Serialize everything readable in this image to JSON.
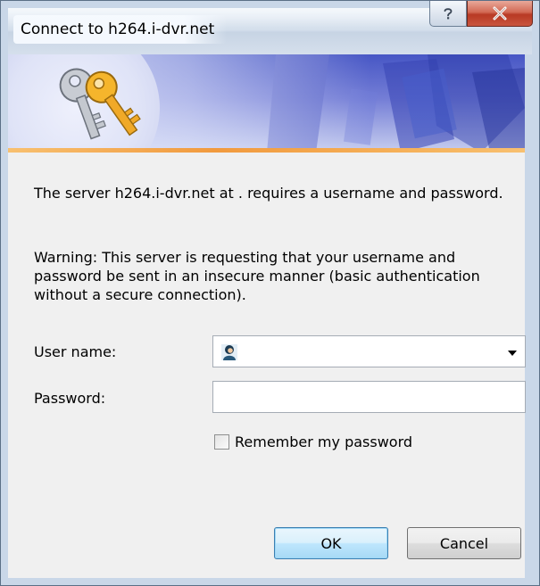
{
  "window": {
    "title": "Connect to h264.i-dvr.net",
    "help_label": "?",
    "close_label": "X"
  },
  "message": {
    "line1": "The server h264.i-dvr.net at . requires a username and password.",
    "warning": "Warning: This server is requesting that your username and password be sent in an insecure manner (basic authentication without a secure connection)."
  },
  "form": {
    "username_label": "User name:",
    "username_value": "",
    "password_label": "Password:",
    "password_value": "",
    "remember_label": "Remember my password",
    "remember_checked": false
  },
  "buttons": {
    "ok": "OK",
    "cancel": "Cancel"
  },
  "icons": {
    "banner": "keys-icon",
    "user": "user-icon",
    "dropdown": "chevron-down-icon"
  }
}
